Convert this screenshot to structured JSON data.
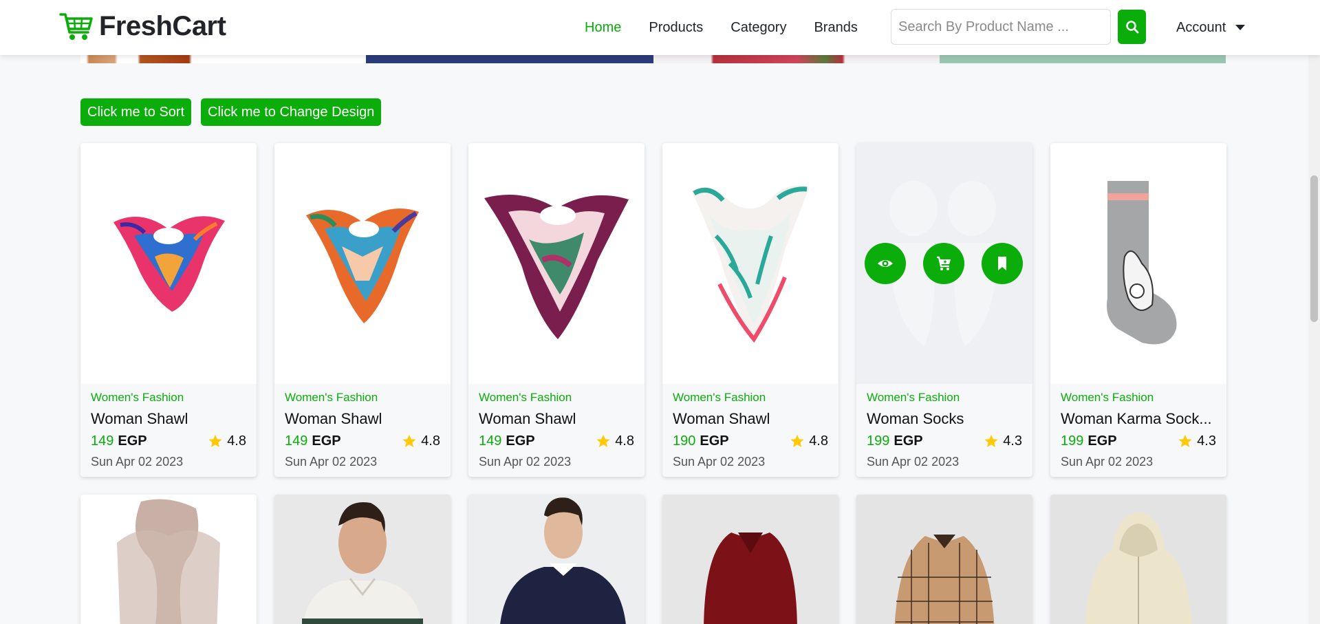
{
  "brand": {
    "name": "FreshCart",
    "icon": "cart-icon"
  },
  "nav": {
    "links": [
      {
        "label": "Home",
        "active": true
      },
      {
        "label": "Products",
        "active": false
      },
      {
        "label": "Category",
        "active": false
      },
      {
        "label": "Brands",
        "active": false
      }
    ],
    "search_placeholder": "Search By Product Name ...",
    "account_label": "Account"
  },
  "actions": {
    "sort_label": "Click me to Sort",
    "design_label": "Click me to Change Design"
  },
  "colors": {
    "accent": "#0aad0a",
    "star": "#ffc908"
  },
  "products": [
    {
      "category": "Women's Fashion",
      "title": "Woman Shawl",
      "price": "149",
      "currency": "EGP",
      "rating": "4.8",
      "date": "Sun Apr 02 2023",
      "image": "scarf-multicolor"
    },
    {
      "category": "Women's Fashion",
      "title": "Woman Shawl",
      "price": "149",
      "currency": "EGP",
      "rating": "4.8",
      "date": "Sun Apr 02 2023",
      "image": "scarf-orange-blue"
    },
    {
      "category": "Women's Fashion",
      "title": "Woman Shawl",
      "price": "149",
      "currency": "EGP",
      "rating": "4.8",
      "date": "Sun Apr 02 2023",
      "image": "scarf-purple"
    },
    {
      "category": "Women's Fashion",
      "title": "Woman Shawl",
      "price": "190",
      "currency": "EGP",
      "rating": "4.8",
      "date": "Sun Apr 02 2023",
      "image": "scarf-floral"
    },
    {
      "category": "Women's Fashion",
      "title": "Woman Socks",
      "price": "199",
      "currency": "EGP",
      "rating": "4.3",
      "date": "Sun Apr 02 2023",
      "image": "socks-white"
    },
    {
      "category": "Women's Fashion",
      "title": "Woman Karma Sock...",
      "price": "199",
      "currency": "EGP",
      "rating": "4.3",
      "date": "Sun Apr 02 2023",
      "image": "sock-grey"
    }
  ],
  "row2_images": [
    "scarf-beige",
    "polo-man",
    "sweater-man",
    "blouse-red",
    "shirt-plaid",
    "hoodie-cream"
  ]
}
